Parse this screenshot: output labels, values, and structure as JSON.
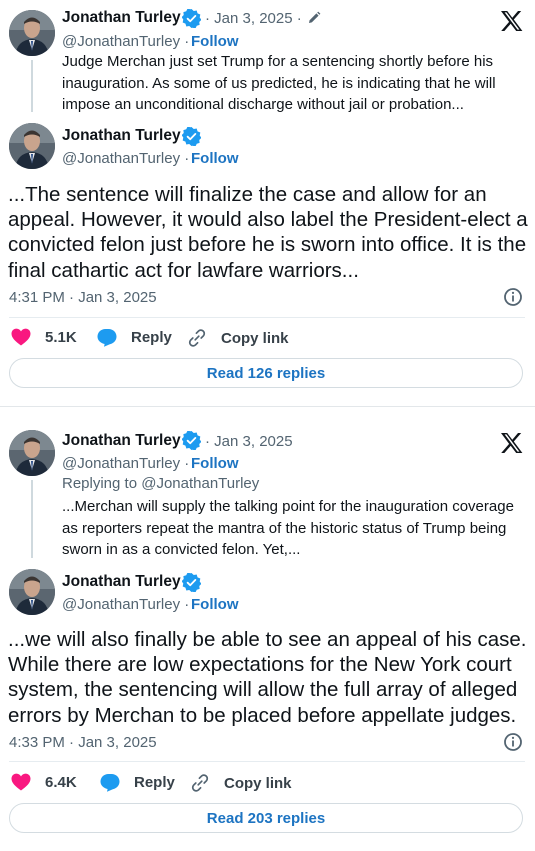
{
  "colors": {
    "link": "#1d74c2",
    "heart": "#f91880",
    "reply_bubble": "#1d9bf0",
    "verified": "#1d9bf0"
  },
  "icons": [
    "verified-badge-icon",
    "edit-pencil-icon",
    "x-logo-icon",
    "info-icon",
    "heart-icon",
    "reply-icon",
    "copy-link-icon"
  ],
  "tweets": [
    {
      "quoted": {
        "name": "Jonathan Turley",
        "date": "· Jan 3, 2025 ·",
        "handle": "@JonathanTurley ·",
        "follow": "Follow",
        "text": "Judge Merchan just set Trump for a sentencing shortly before his inauguration. As some of us predicted, he is indicating that he will impose an unconditional discharge without jail or probation..."
      },
      "main": {
        "name": "Jonathan Turley",
        "handle": "@JonathanTurley ·",
        "follow": "Follow",
        "text": "...The sentence will finalize the case and allow for an appeal. However, it would also label the President-elect a convicted felon just before he is sworn into office. It is the final cathartic act for lawfare warriors...",
        "timestamp": "4:31 PM · Jan 3, 2025"
      },
      "actions": {
        "likes": "5.1K",
        "reply": "Reply",
        "copy": "Copy link"
      },
      "read_replies": "Read 126 replies"
    },
    {
      "quoted": {
        "name": "Jonathan Turley",
        "date": "· Jan 3, 2025",
        "handle": "@JonathanTurley ·",
        "follow": "Follow",
        "replying_to": "Replying to @JonathanTurley",
        "text": "...Merchan will supply the talking point for the inauguration coverage as reporters repeat the mantra of the historic status of Trump being sworn in as a convicted felon. Yet,..."
      },
      "main": {
        "name": "Jonathan Turley",
        "handle": "@JonathanTurley ·",
        "follow": "Follow",
        "text": "...we will also finally be able to see an appeal of his case. While there are low expectations for the New York court system, the sentencing will allow the full array of alleged errors by Merchan to be placed before appellate judges.",
        "timestamp": "4:33 PM · Jan 3, 2025"
      },
      "actions": {
        "likes": "6.4K",
        "reply": "Reply",
        "copy": "Copy link"
      },
      "read_replies": "Read 203 replies"
    }
  ]
}
